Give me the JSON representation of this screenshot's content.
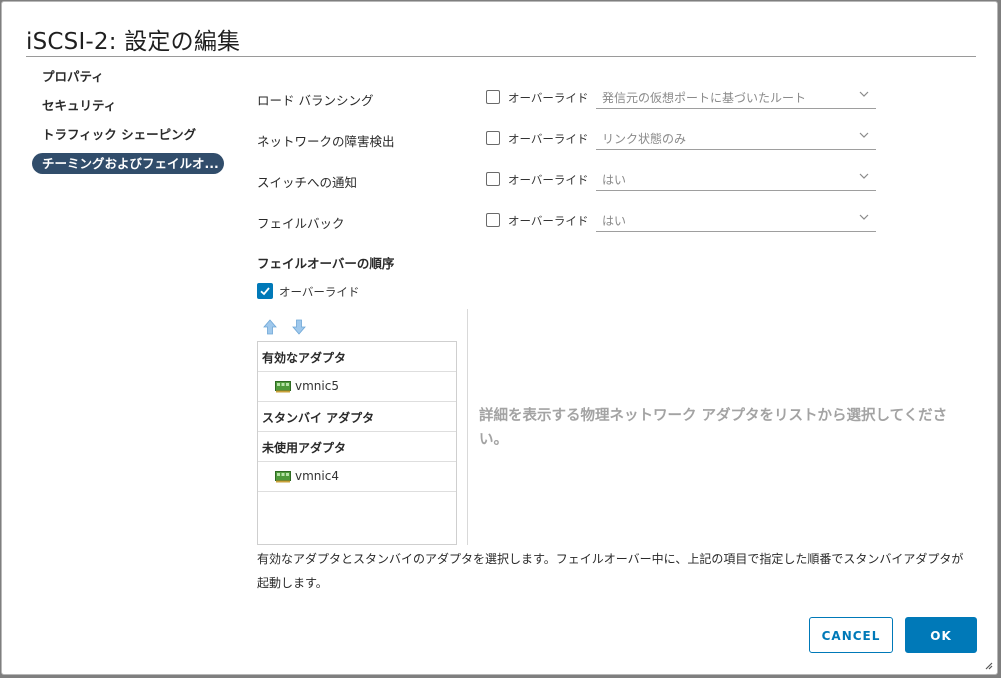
{
  "dialog": {
    "title": "iSCSI-2: 設定の編集"
  },
  "nav": {
    "items": [
      {
        "label": "プロパティ",
        "active": false
      },
      {
        "label": "セキュリティ",
        "active": false
      },
      {
        "label": "トラフィック シェーピング",
        "active": false
      },
      {
        "label": "チーミングおよびフェイルオ...",
        "active": true
      }
    ]
  },
  "settings": {
    "override_label": "オーバーライド",
    "rows": [
      {
        "label": "ロード バランシング",
        "override_checked": false,
        "value": "発信元の仮想ポートに基づいたルート"
      },
      {
        "label": "ネットワークの障害検出",
        "override_checked": false,
        "value": "リンク状態のみ"
      },
      {
        "label": "スイッチへの通知",
        "override_checked": false,
        "value": "はい"
      },
      {
        "label": "フェイルバック",
        "override_checked": false,
        "value": "はい"
      }
    ]
  },
  "failover": {
    "heading": "フェイルオーバーの順序",
    "override_label": "オーバーライド",
    "override_checked": true,
    "groups": {
      "active": {
        "label": "有効なアダプタ",
        "adapters": [
          "vmnic5"
        ]
      },
      "standby": {
        "label": "スタンバイ アダプタ",
        "adapters": []
      },
      "unused": {
        "label": "未使用アダプタ",
        "adapters": [
          "vmnic4"
        ]
      }
    },
    "detail_message": "詳細を表示する物理ネットワーク アダプタをリストから選択してください。",
    "footnote": "有効なアダプタとスタンバイのアダプタを選択します。フェイルオーバー中に、上記の項目で指定した順番でスタンバイアダプタが起動します。"
  },
  "buttons": {
    "cancel": "CANCEL",
    "ok": "OK"
  },
  "colors": {
    "accent": "#0079b8",
    "nav_active": "#314d6b"
  }
}
